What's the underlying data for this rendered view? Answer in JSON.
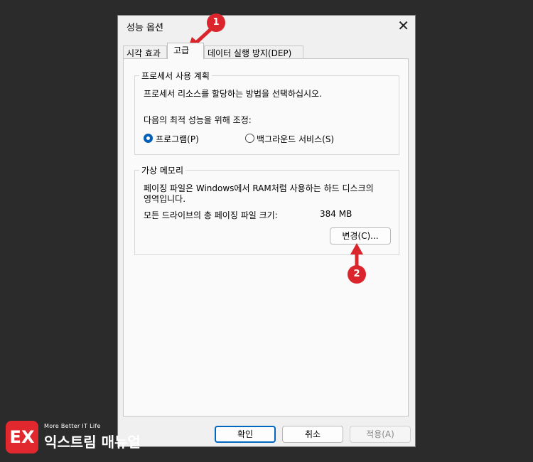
{
  "dialog": {
    "title": "성능 옵션",
    "close_glyph": "✕"
  },
  "tabs": [
    {
      "label": "시각 효과",
      "active": false
    },
    {
      "label": "고급",
      "active": true
    },
    {
      "label": "데이터 실행 방지(DEP)",
      "active": false
    }
  ],
  "processor": {
    "group_title": "프로세서 사용 계획",
    "description": "프로세서 리소스를 할당하는 방법을 선택하십시오.",
    "adjust_label": "다음의 최적 성능을 위해 조정:",
    "options": [
      {
        "label": "프로그램(P)",
        "selected": true
      },
      {
        "label": "백그라운드 서비스(S)",
        "selected": false
      }
    ]
  },
  "virtual_memory": {
    "group_title": "가상 메모리",
    "description_line1": "페이징 파일은 Windows에서 RAM처럼 사용하는 하드 디스크의",
    "description_line2": "영역입니다.",
    "total_label": "모든 드라이브의 총 페이징 파일 크기:",
    "total_value": "384 MB",
    "change_button": "변경(C)..."
  },
  "footer": {
    "ok": "확인",
    "cancel": "취소",
    "apply": "적용(A)"
  },
  "annotations": {
    "marker1": "1",
    "marker2": "2",
    "color": "#d9252b"
  },
  "brand": {
    "logo_text": "EX",
    "tagline": "More Better IT Life",
    "name": "익스트림 매뉴얼"
  }
}
